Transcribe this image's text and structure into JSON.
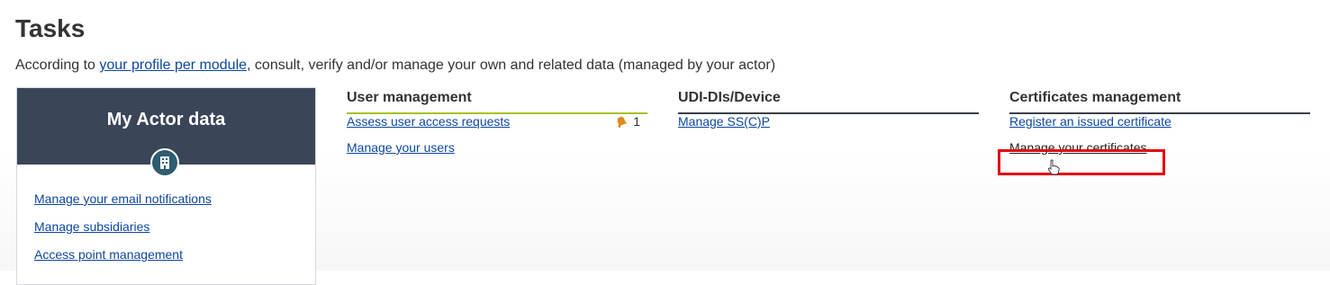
{
  "page": {
    "title": "Tasks",
    "intro_prefix": "According to ",
    "intro_link": "your profile per module",
    "intro_suffix": ", consult, verify and/or manage your own and related data (managed by your actor)"
  },
  "actor_card": {
    "title": "My Actor data",
    "icon": "building-icon",
    "links": [
      "Manage your email notifications",
      "Manage subsidiaries",
      "Access point management"
    ]
  },
  "user_management": {
    "title": "User management",
    "links": [
      "Assess user access requests",
      "Manage your users"
    ],
    "badge_count": "1",
    "badge_icon": "bell-icon"
  },
  "udi_device": {
    "title": "UDI-DIs/Device",
    "links": [
      "Manage SS(C)P"
    ]
  },
  "certificates": {
    "title": "Certificates management",
    "links": [
      "Register an issued certificate",
      "Manage your certificates"
    ]
  },
  "colors": {
    "link": "#0e47a1",
    "header_dark": "#3a4657",
    "accent_green": "#a9c126",
    "highlight_red": "#e30613",
    "badge_orange": "#e08a1e"
  }
}
